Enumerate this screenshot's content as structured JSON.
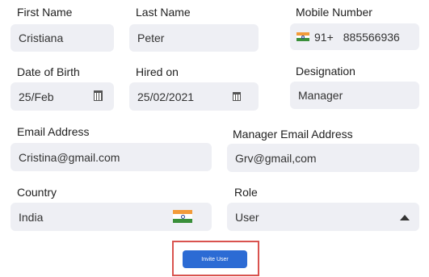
{
  "form": {
    "first_name": {
      "label": "First Name",
      "value": "Cristiana"
    },
    "last_name": {
      "label": "Last Name",
      "value": "Peter"
    },
    "mobile": {
      "label": "Mobile Number",
      "code": "91+",
      "value": "885566936"
    },
    "dob": {
      "label": "Date of Birth",
      "value": "25/Feb"
    },
    "hired_on": {
      "label": "Hired on",
      "value": "25/02/2021"
    },
    "designation": {
      "label": "Designation",
      "value": "Manager"
    },
    "email": {
      "label": "Email Address",
      "value": "Cristina@gmail.com"
    },
    "manager_email": {
      "label": "Manager Email Address",
      "value": "Grv@gmail,com"
    },
    "country": {
      "label": "Country",
      "value": "India"
    },
    "role": {
      "label": "Role",
      "value": "User"
    }
  },
  "actions": {
    "invite_label": "Invite User"
  },
  "icons": {
    "calendar": "calendar-icon",
    "flag": "india-flag-icon",
    "dropdown": "caret-up-icon"
  },
  "colors": {
    "field_bg": "#eeeff4",
    "button": "#2c6bd4",
    "highlight_border": "#d9534f"
  }
}
